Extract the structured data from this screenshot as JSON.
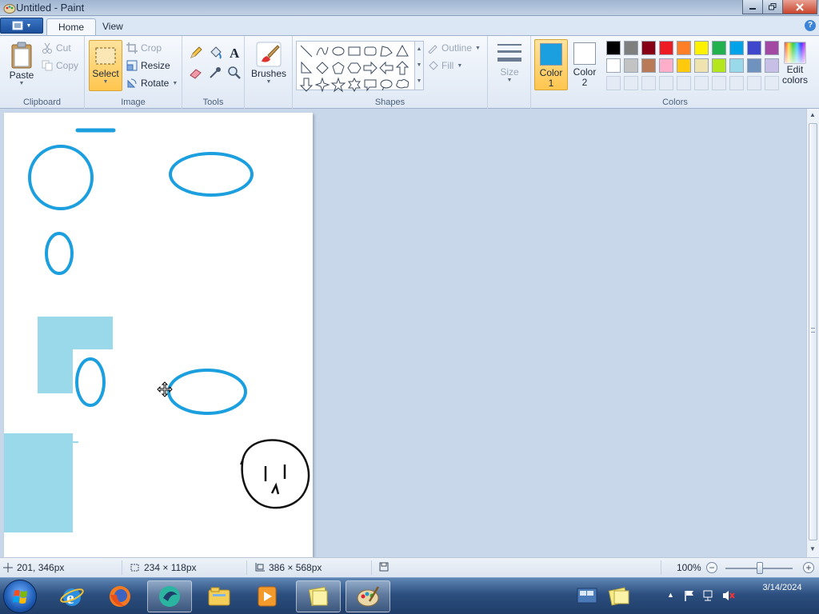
{
  "window": {
    "title": "Untitled - Paint"
  },
  "tabs": [
    {
      "label": "Home"
    },
    {
      "label": "View"
    }
  ],
  "clipboard": {
    "paste": "Paste",
    "cut": "Cut",
    "copy": "Copy",
    "group": "Clipboard"
  },
  "image": {
    "select": "Select",
    "crop": "Crop",
    "resize": "Resize",
    "rotate": "Rotate",
    "group": "Image"
  },
  "tools": {
    "group": "Tools"
  },
  "brushes": {
    "label": "Brushes"
  },
  "shapes": {
    "outline": "Outline",
    "fill": "Fill",
    "group": "Shapes"
  },
  "size": {
    "label": "Size"
  },
  "colors": {
    "group": "Colors",
    "color1_label": "Color",
    "color1_num": "1",
    "color2_label": "Color",
    "color2_num": "2",
    "edit_label": "Edit",
    "edit_label2": "colors",
    "color1_value": "#1c9fdf",
    "color2_value": "#ffffff",
    "palette": [
      "#000000",
      "#7f7f7f",
      "#880015",
      "#ed1c24",
      "#ff7f27",
      "#fff200",
      "#22b14c",
      "#00a2e8",
      "#3f48cc",
      "#a349a4",
      "#ffffff",
      "#c3c3c3",
      "#b97a57",
      "#ffaec9",
      "#ffc90e",
      "#efe4b0",
      "#b5e61d",
      "#99d9ea",
      "#7092be",
      "#c8bfe7"
    ]
  },
  "status": {
    "cursor_pos": "201, 346px",
    "selection_size": "234 × 118px",
    "canvas_size": "386 × 568px",
    "zoom": "100%"
  },
  "clock": {
    "time": "",
    "date": "3/14/2024"
  }
}
